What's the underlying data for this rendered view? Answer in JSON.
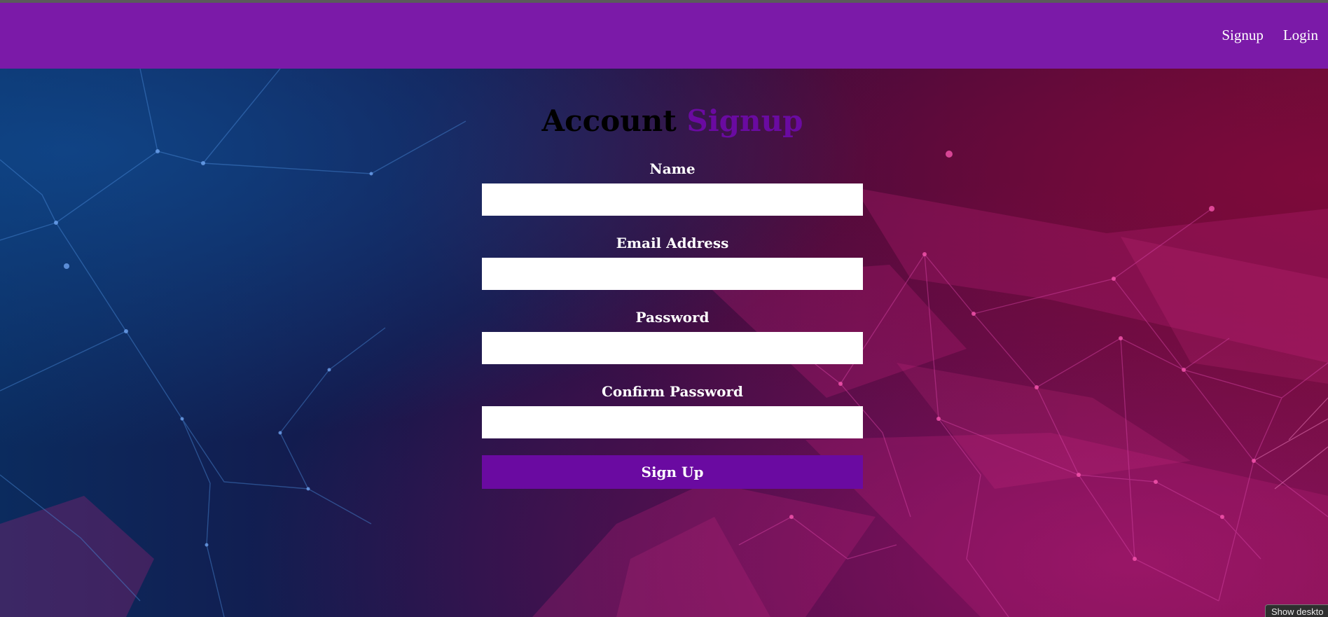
{
  "nav": {
    "links": [
      {
        "label": "Signup"
      },
      {
        "label": "Login"
      }
    ]
  },
  "form": {
    "title_part1": "Account",
    "title_part2": "Signup",
    "fields": [
      {
        "label": "Name",
        "value": ""
      },
      {
        "label": "Email Address",
        "value": ""
      },
      {
        "label": "Password",
        "value": ""
      },
      {
        "label": "Confirm Password",
        "value": ""
      }
    ],
    "submit_label": "Sign Up"
  },
  "tooltip": {
    "text": "Show deskto"
  },
  "colors": {
    "navbar": "#7b1aa8",
    "accent": "#6a0aa1",
    "input_bg": "#ffffff",
    "label_text": "#ffffff"
  }
}
